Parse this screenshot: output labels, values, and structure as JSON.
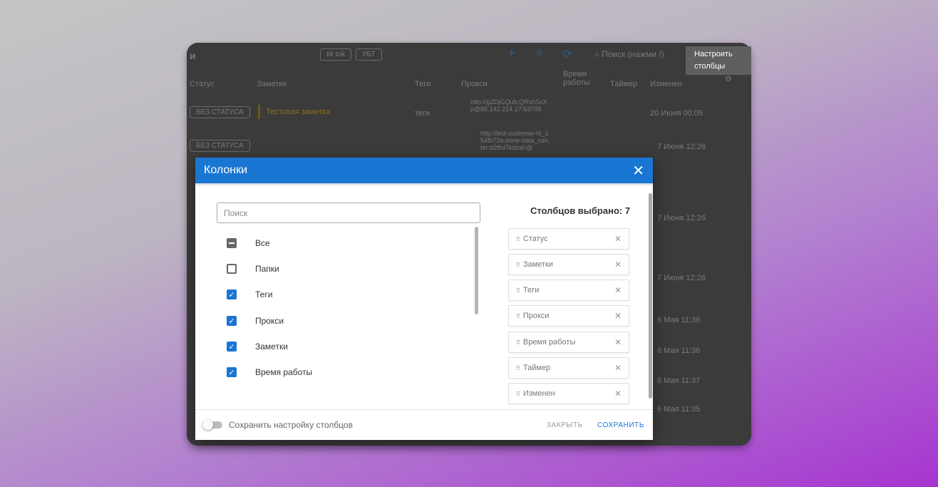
{
  "background_app": {
    "title_fragment": "и",
    "tags": [
      "tik tok",
      "УБТ"
    ],
    "search_placeholder": "Поиск (нажми /)",
    "columns": [
      "Статус",
      "Заметки",
      "Теги",
      "Прокси",
      "Время работы",
      "Таймер",
      "Изменен"
    ],
    "row1": {
      "status": "БЕЗ СТАТУСА",
      "note": "Тестовая заметка",
      "tags": "теги",
      "proxy": "http://gZDjGQub:QRshSxXp@85.142.214.17:63799",
      "changed": "20 Июня 00:05"
    },
    "row2": {
      "status": "БЕЗ СТАТУСА",
      "proxy": "http://brd-customer-hl_154fb72a-zone-data_center:d2tful7kdzah@",
      "changed": "7 Июня 12:26"
    },
    "changed_dates": [
      "7 Июня 12:26",
      "7 Июня 12:26",
      "6 Мая 11:36",
      "6 Мая 11:36",
      "6 Мая 11:37",
      "6 Мая 11:35"
    ]
  },
  "tooltip": {
    "line1": "Настроить",
    "line2": "столбцы"
  },
  "dialog": {
    "title": "Колонки",
    "search_placeholder": "Поиск",
    "items": [
      {
        "label": "Все",
        "state": "indeterminate"
      },
      {
        "label": "Папки",
        "state": "unchecked"
      },
      {
        "label": "Теги",
        "state": "checked"
      },
      {
        "label": "Прокси",
        "state": "checked"
      },
      {
        "label": "Заметки",
        "state": "checked"
      },
      {
        "label": "Время работы",
        "state": "checked"
      }
    ],
    "selected_count_label": "Столбцов выбрано: 7",
    "selected": [
      "Статус",
      "Заметки",
      "Теги",
      "Прокси",
      "Время работы",
      "Таймер",
      "Изменен"
    ],
    "save_setting_label": "Сохранить настройку столбцов",
    "save_setting_on": false,
    "close_label": "ЗАКРЫТЬ",
    "save_label": "СОХРАНИТЬ"
  },
  "colors": {
    "primary": "#1976d2"
  }
}
